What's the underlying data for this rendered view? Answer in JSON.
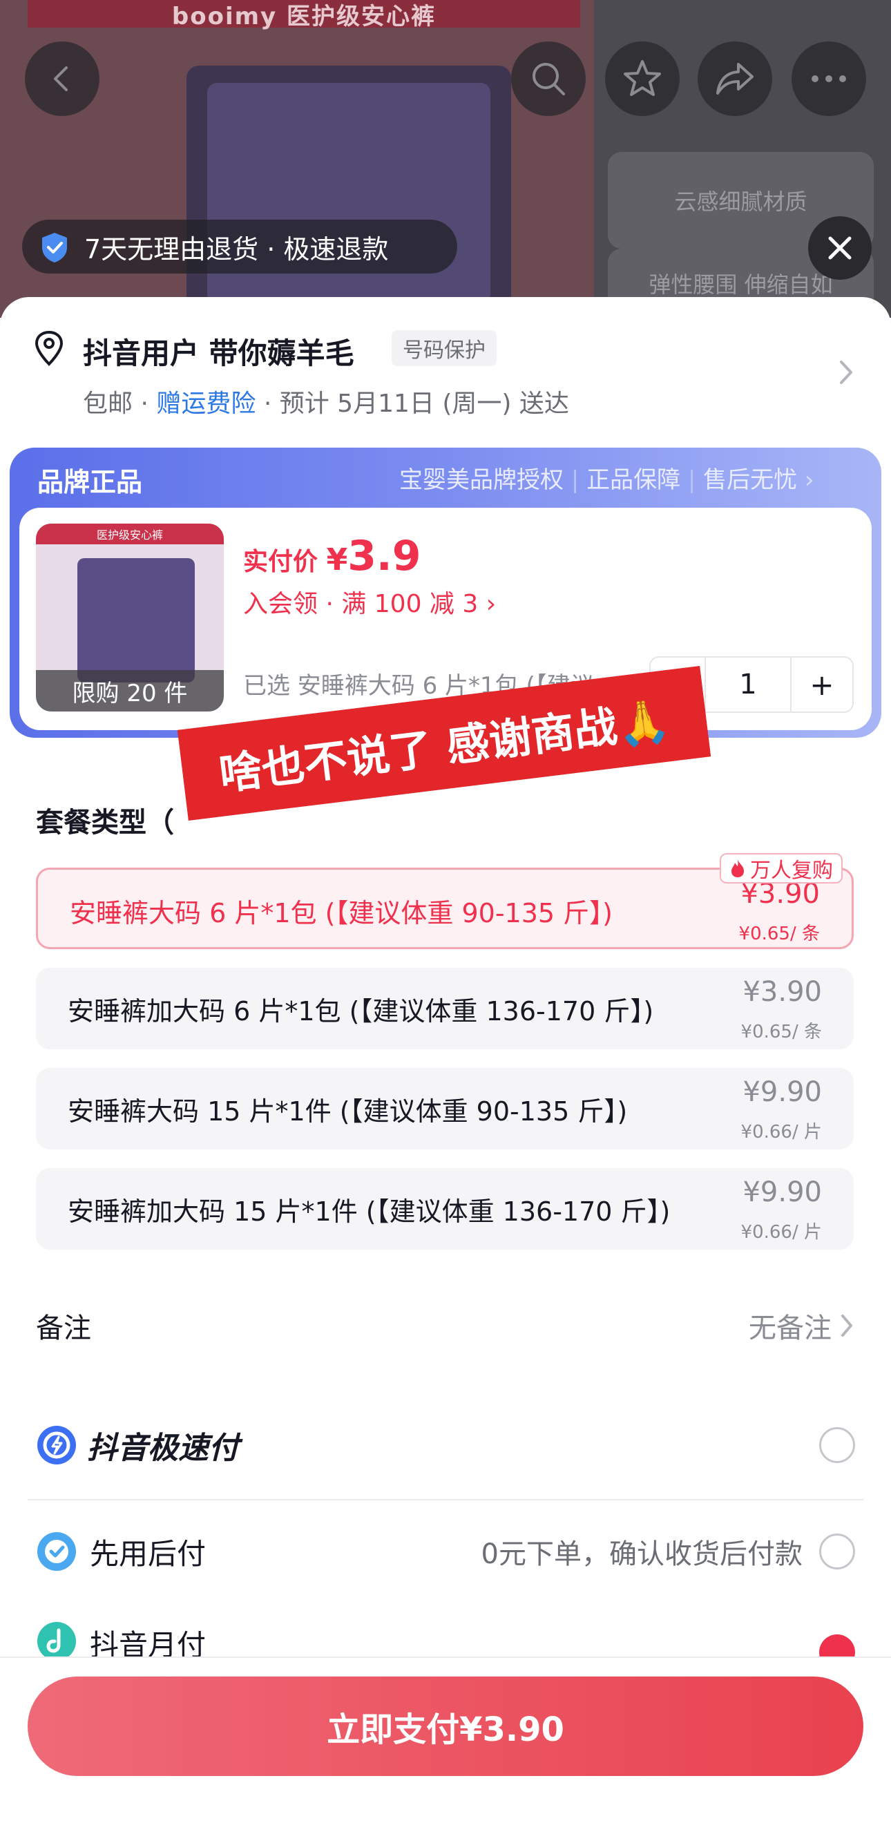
{
  "hero": {
    "banner_text": "booimy  医护级安心裤",
    "feature_card_1": "云感细腻材质",
    "feature_card_2": "弹性腰围 伸缩自如"
  },
  "return_pill": {
    "text": "7天无理由退货 · 极速退款"
  },
  "address": {
    "name": "抖音用户 带你薅羊毛",
    "privacy_tag": "号码保护",
    "free_shipping": "包邮",
    "insurance": "赠运费险",
    "delivery": "预计 5月11日 (周一) 送达"
  },
  "brand": {
    "title": "品牌正品",
    "tags": [
      "宝婴美品牌授权",
      "正品保障",
      "售后无忧"
    ]
  },
  "product": {
    "thumb_title": "医护级安心裤",
    "limit": "限购 20 件",
    "price_label": "实付价",
    "price_currency": "¥",
    "price_value": "3.9",
    "promo": "入会领 · 满 100 减 3",
    "selected": "已选  安睡裤大码 6 片*1包 (【建议体重90-135斤】)",
    "quantity": "1",
    "minus": "−",
    "plus": "+"
  },
  "sticker": {
    "text": "啥也不说了 感谢商战🙏"
  },
  "package": {
    "title": "套餐类型（",
    "hot_badge": "万人复购",
    "options": [
      {
        "name": "安睡裤大码 6 片*1包 (【建议体重 90-135 斤】)",
        "price": "¥3.90",
        "unit": "¥0.65/ 条",
        "selected": true
      },
      {
        "name": "安睡裤加大码 6 片*1包 (【建议体重 136-170 斤】)",
        "price": "¥3.90",
        "unit": "¥0.65/ 条",
        "selected": false
      },
      {
        "name": "安睡裤大码 15 片*1件 (【建议体重 90-135 斤】)",
        "price": "¥9.90",
        "unit": "¥0.66/ 片",
        "selected": false
      },
      {
        "name": "安睡裤加大码 15 片*1件 (【建议体重 136-170 斤】)",
        "price": "¥9.90",
        "unit": "¥0.66/ 片",
        "selected": false
      }
    ]
  },
  "note": {
    "label": "备注",
    "value": "无备注"
  },
  "payment": {
    "method_1": "抖音极速付",
    "method_2": "先用后付",
    "method_2_desc": "0元下单，确认收货后付款",
    "method_3": "抖音月付"
  },
  "pay_button": {
    "label": "立即支付¥3.90"
  },
  "colors": {
    "accent_red": "#f0314e",
    "link_blue": "#2c79e6",
    "brand_blue": "#5b6fe9"
  }
}
